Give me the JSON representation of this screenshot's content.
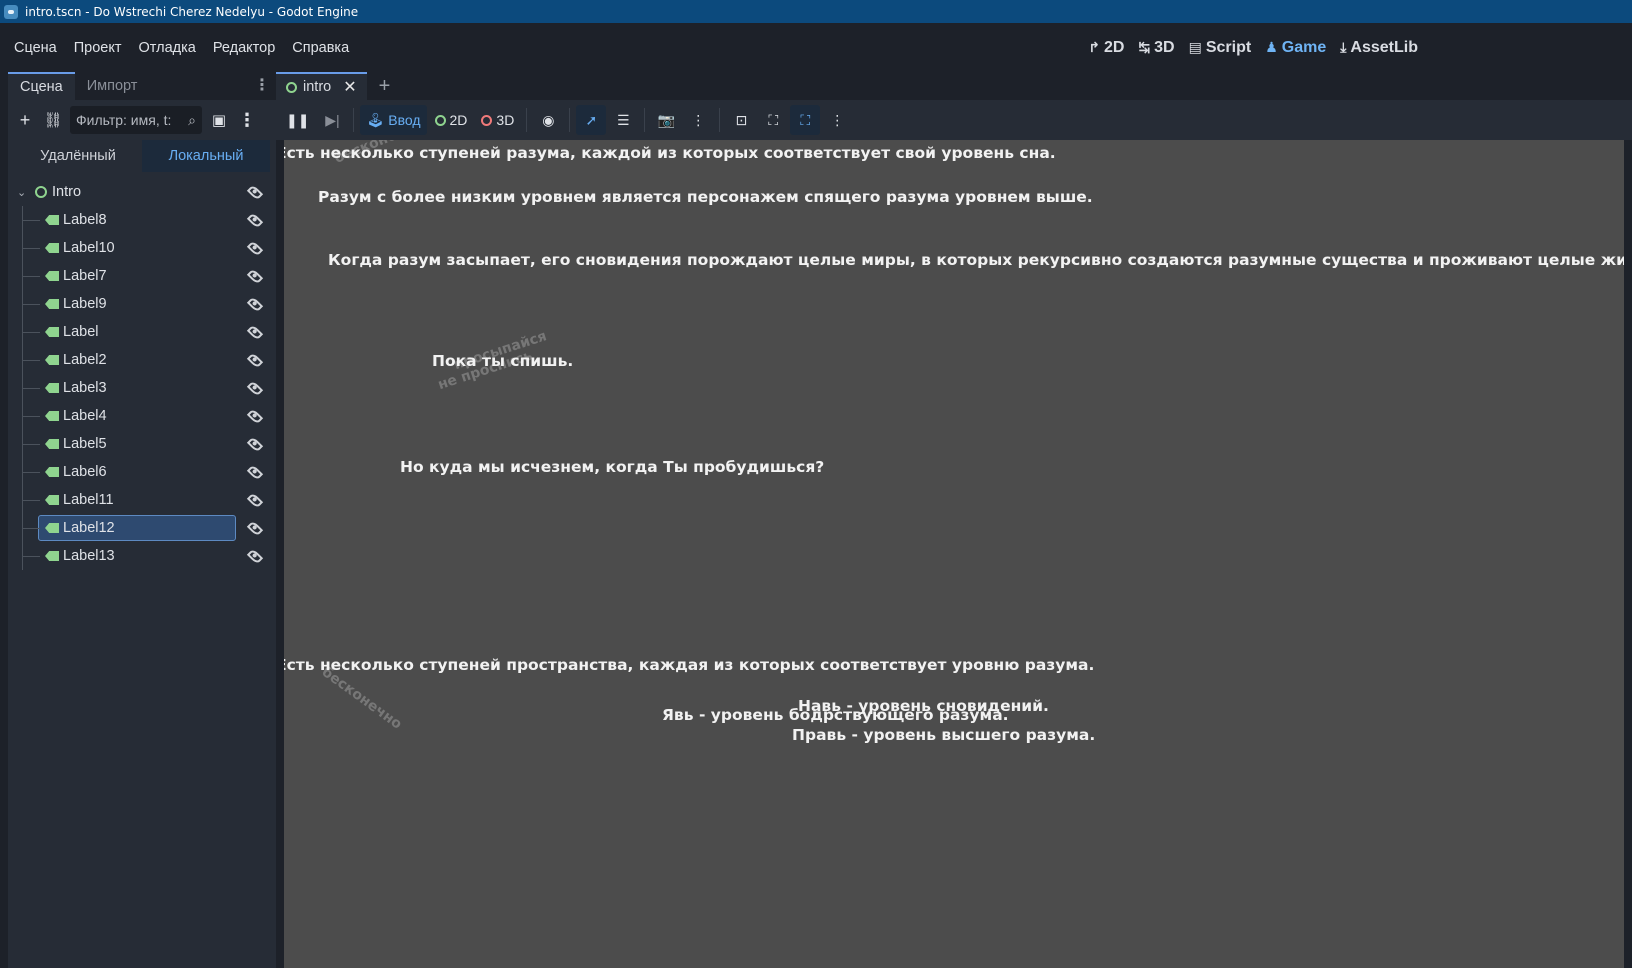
{
  "window": {
    "title": "intro.tscn - Do Wstrechi Cherez Nedelyu - Godot Engine"
  },
  "menu": [
    "Сцена",
    "Проект",
    "Отладка",
    "Редактор",
    "Справка"
  ],
  "workspaces": [
    {
      "label": "2D",
      "icon": "2d-icon"
    },
    {
      "label": "3D",
      "icon": "3d-icon"
    },
    {
      "label": "Script",
      "icon": "script-icon"
    },
    {
      "label": "Game",
      "icon": "game-icon",
      "active": true
    },
    {
      "label": "AssetLib",
      "icon": "assetlib-icon"
    }
  ],
  "dock": {
    "tabs": [
      "Сцена",
      "Импорт"
    ],
    "filter_placeholder": "Фильтр: имя, t:",
    "mode_buttons": [
      "Удалённый",
      "Локальный"
    ],
    "active_mode": "Локальный",
    "root": "Intro",
    "children": [
      "Label8",
      "Label10",
      "Label7",
      "Label9",
      "Label",
      "Label2",
      "Label3",
      "Label4",
      "Label5",
      "Label6",
      "Label11",
      "Label12",
      "Label13"
    ],
    "selected": "Label12"
  },
  "scene_tab": {
    "label": "intro"
  },
  "toolbar": {
    "input_label": "Ввод",
    "mode_2d": "2D",
    "mode_3d": "3D"
  },
  "game": {
    "lines": [
      "Есть несколько ступеней разума, каждой из которых соответствует свой уровень сна.",
      "Разум с более низким уровнем является персонажем спящего разума уровнем выше.",
      "Когда разум засыпает, его сновидения порождают целые миры, в которых рекурсивно создаются разумные существа и проживают целые жизни.",
      "Пока ты спишь.",
      "Но куда мы исчезнем, когда Ты пробудишься?",
      "Есть несколько ступеней пространства, каждая из которых соответствует уровню разума.",
      "Навь - уровень сновидений.",
      "Явь - уровень бодрствующего разума.",
      "Правь - уровень высшего разума."
    ],
    "faint": [
      "бесконечно",
      "просыпайся",
      "не проснись",
      "бесконечно"
    ]
  }
}
